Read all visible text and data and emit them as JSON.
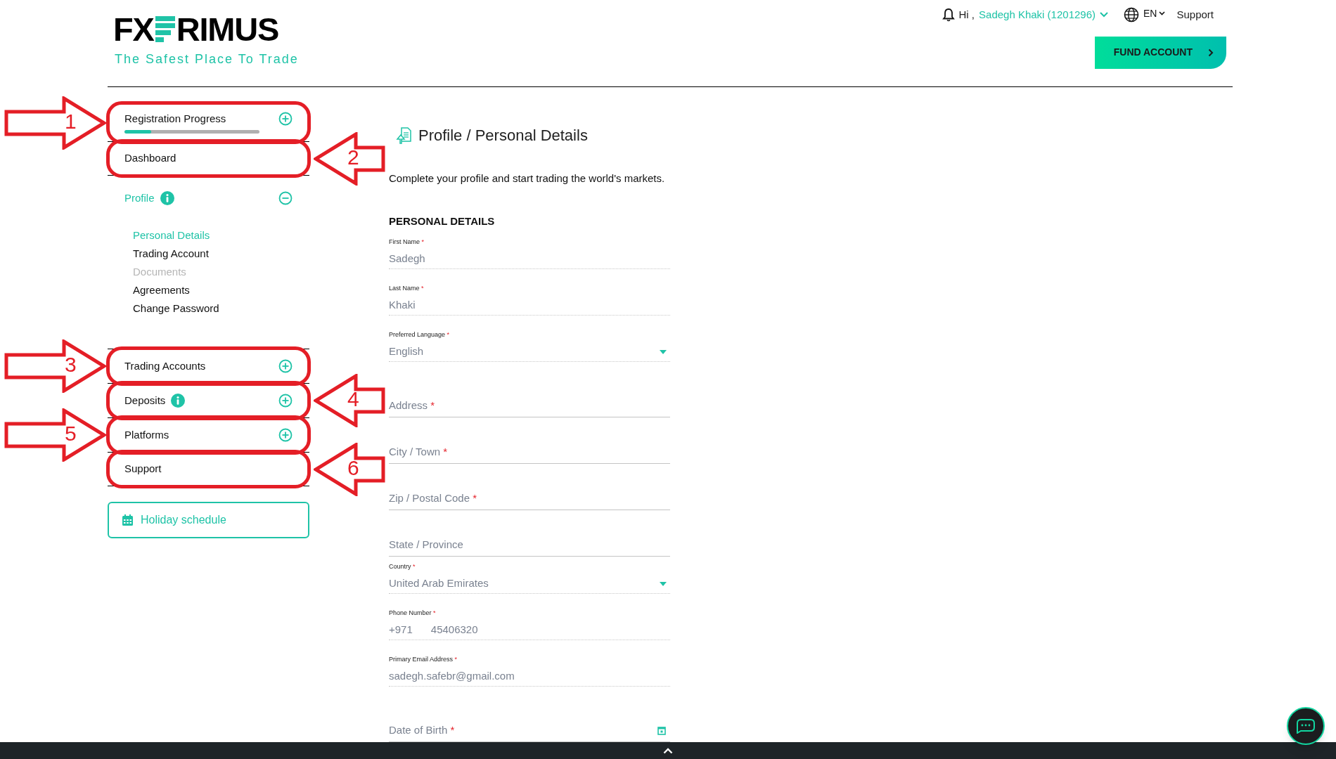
{
  "logo": {
    "left": "FX",
    "right": "RIMUS",
    "tagline": "The Safest Place To Trade"
  },
  "header": {
    "greeting": "Hi ,",
    "user": "Sadegh Khaki (1201296)",
    "language": "EN",
    "support": "Support",
    "fund_button": "FUND ACCOUNT"
  },
  "sidebar": {
    "items": [
      {
        "label": "Registration Progress",
        "kind": "progress",
        "level": 0.2,
        "annotation": {
          "number": "1",
          "kind": "right_arrow"
        }
      },
      {
        "label": "Dashboard",
        "kind": "link",
        "annotation": {
          "number": "2",
          "kind": "left_arrow"
        }
      },
      {
        "label": "Profile",
        "kind": "group",
        "info": true,
        "expanded": true,
        "children": [
          {
            "label": "Personal Details",
            "selected": true,
            "disabled": false
          },
          {
            "label": "Trading Account",
            "selected": false,
            "disabled": false
          },
          {
            "label": "Documents",
            "selected": false,
            "disabled": true
          },
          {
            "label": "Agreements",
            "selected": false,
            "disabled": false
          },
          {
            "label": "Change Password",
            "selected": false,
            "disabled": false
          }
        ]
      },
      {
        "label": "Trading Accounts",
        "kind": "group",
        "info": false,
        "expanded": false,
        "annotation": {
          "number": "3",
          "kind": "right_arrow"
        }
      },
      {
        "label": "Deposits",
        "kind": "group",
        "info": true,
        "expanded": false,
        "annotation": {
          "number": "4",
          "kind": "left_arrow"
        }
      },
      {
        "label": "Platforms",
        "kind": "group",
        "info": false,
        "expanded": false,
        "annotation": {
          "number": "5",
          "kind": "right_arrow"
        }
      },
      {
        "label": "Support",
        "kind": "link",
        "annotation": {
          "number": "6",
          "kind": "left_arrow"
        }
      }
    ],
    "holiday_button": "Holiday schedule"
  },
  "main": {
    "title": "Profile / Personal Details",
    "subtitle": "Complete your profile and start trading the world's markets.",
    "section": "PERSONAL DETAILS",
    "fields": [
      {
        "kind": "filled",
        "label": "First Name",
        "required_mark": "*",
        "value": "Sadegh"
      },
      {
        "kind": "filled",
        "label": "Last Name",
        "required_mark": "*",
        "value": "Khaki"
      },
      {
        "kind": "select",
        "label": "Preferred Language",
        "required_mark": "*",
        "value": "English"
      },
      {
        "kind": "empty",
        "placeholder": "Address",
        "required_mark": "*"
      },
      {
        "kind": "empty",
        "placeholder": "City / Town",
        "required_mark": "*"
      },
      {
        "kind": "empty",
        "placeholder": "Zip / Postal Code",
        "required_mark": "*"
      },
      {
        "kind": "empty",
        "placeholder": "State / Province"
      },
      {
        "kind": "select",
        "label": "Country",
        "required_mark": "*",
        "value": "United Arab Emirates"
      },
      {
        "kind": "phone",
        "label": "Phone Number",
        "required_mark": "*",
        "code": "+971",
        "value": "45406320"
      },
      {
        "kind": "filled",
        "label": "Primary Email Address",
        "required_mark": "*",
        "value": "sadegh.safebr@gmail.com"
      },
      {
        "kind": "date",
        "placeholder": "Date of Birth",
        "required_mark": "*"
      }
    ]
  }
}
